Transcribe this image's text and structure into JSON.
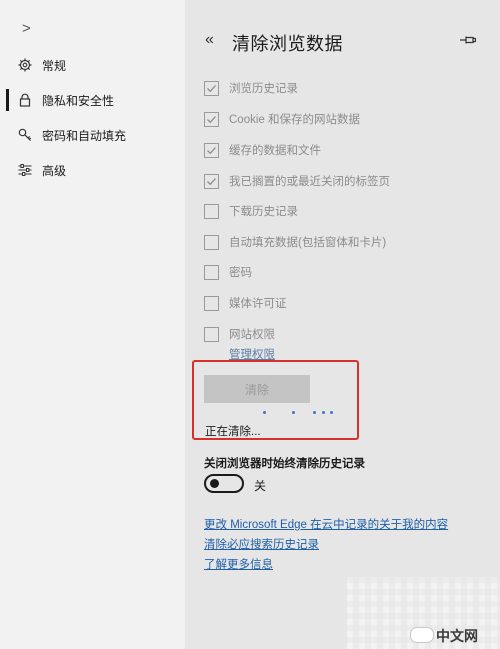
{
  "nav": {
    "expand_icon": ">",
    "items": [
      {
        "label": "常规",
        "icon": "gear-icon"
      },
      {
        "label": "隐私和安全性",
        "icon": "lock-icon",
        "active": true
      },
      {
        "label": "密码和自动填充",
        "icon": "key-icon"
      },
      {
        "label": "高级",
        "icon": "sliders-icon"
      }
    ]
  },
  "panel": {
    "back_icon": "«",
    "title": "清除浏览数据",
    "options": [
      {
        "label": "浏览历史记录",
        "checked": true
      },
      {
        "label": "Cookie 和保存的网站数据",
        "checked": true
      },
      {
        "label": "缓存的数据和文件",
        "checked": true
      },
      {
        "label": "我已搁置的或最近关闭的标签页",
        "checked": true
      },
      {
        "label": "下载历史记录",
        "checked": false
      },
      {
        "label": "自动填充数据(包括窗体和卡片)",
        "checked": false
      },
      {
        "label": "密码",
        "checked": false
      },
      {
        "label": "媒体许可证",
        "checked": false
      },
      {
        "label": "网站权限",
        "checked": false
      }
    ],
    "manage_link": "管理权限",
    "clear_button": "清除",
    "clearing_status": "正在清除...",
    "always_clear_label": "关闭浏览器时始终清除历史记录",
    "toggle_state": "关",
    "links": [
      "更改 Microsoft Edge 在云中记录的关于我的内容",
      "清除必应搜索历史记录",
      "了解更多信息"
    ]
  },
  "watermark": {
    "text": "中文网",
    "logo": "php"
  },
  "colors": {
    "accent": "#1f5fa8",
    "highlight_border": "#d9302b",
    "dots": "#3b78c2"
  }
}
